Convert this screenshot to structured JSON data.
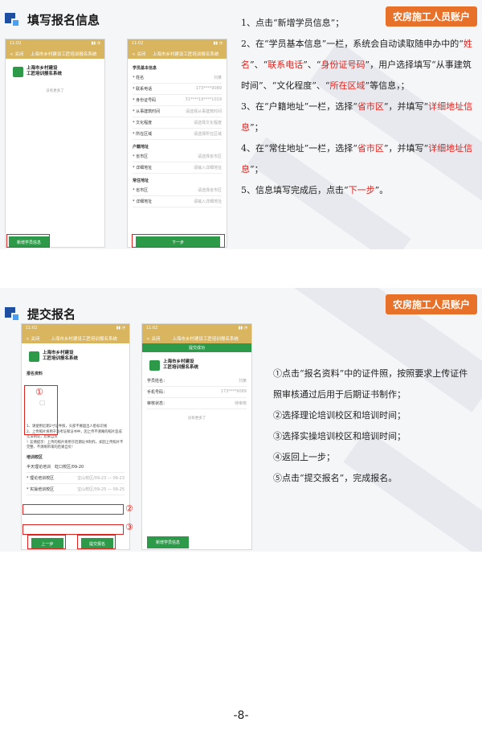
{
  "slide1": {
    "title": "填写报名信息",
    "badge": "农房施工人员账户",
    "phone_left": {
      "time": "11:02",
      "nav_back": "< 关闭",
      "nav_title": "上海市乡村建设工匠培训报名系统",
      "app_name_line1": "上海市乡村建设",
      "app_name_line2": "工匠培训报名系统",
      "empty": "没有更多了",
      "button": "新增学员信息"
    },
    "phone_right": {
      "time": "11:02",
      "nav_back": "< 关闭",
      "nav_title": "上海市乡村建设工匠培训报名系统",
      "group1": "学员基本信息",
      "rows1": [
        {
          "k": "* 姓名",
          "v": "刘某"
        },
        {
          "k": "* 联系电话",
          "v": "173****9089"
        },
        {
          "k": "* 身份证号码",
          "v": "31****19****1019"
        },
        {
          "k": "* 从事建筑时间",
          "v": "请选择从事建筑时间"
        },
        {
          "k": "* 文化程度",
          "v": "请选择文化程度"
        },
        {
          "k": "* 所在区域",
          "v": "请选择所在区域"
        }
      ],
      "group2": "户籍地址",
      "rows2": [
        {
          "k": "* 省市区",
          "v": "请选择省市区"
        },
        {
          "k": "* 详细地址",
          "v": "请输入详细地址"
        }
      ],
      "group3": "常住地址",
      "rows3": [
        {
          "k": "* 省市区",
          "v": "请选择省市区"
        },
        {
          "k": "* 详细地址",
          "v": "请输入详细地址"
        }
      ],
      "button": "下一步"
    },
    "steps": [
      {
        "parts": [
          {
            "t": "1、点击“新增学员信息”；",
            "r": false
          }
        ]
      },
      {
        "parts": [
          {
            "t": "2、在“学员基本信息”一栏，系统会自动读取随申办中的“",
            "r": false
          },
          {
            "t": "姓名",
            "r": true
          },
          {
            "t": "”、“",
            "r": false
          },
          {
            "t": "联系电话",
            "r": true
          },
          {
            "t": "”、“",
            "r": false
          },
          {
            "t": "身份证号码",
            "r": true
          },
          {
            "t": "”，用户选择填写“从事建筑时间”、“文化程度”、“",
            "r": false
          },
          {
            "t": "所在区域",
            "r": true
          },
          {
            "t": "”等信息，；",
            "r": false
          }
        ]
      },
      {
        "parts": [
          {
            "t": "3、在“户籍地址”一栏，选择“",
            "r": false
          },
          {
            "t": "省市区",
            "r": true
          },
          {
            "t": "”，并填写“",
            "r": false
          },
          {
            "t": "详细地址信息",
            "r": true
          },
          {
            "t": "”；",
            "r": false
          }
        ]
      },
      {
        "parts": [
          {
            "t": "4、在“常住地址”一栏，选择“",
            "r": false
          },
          {
            "t": "省市区",
            "r": true
          },
          {
            "t": "”，并填写“",
            "r": false
          },
          {
            "t": "详细地址信息",
            "r": true
          },
          {
            "t": "”；",
            "r": false
          }
        ]
      },
      {
        "parts": [
          {
            "t": "5、信息填写完成后，点击“",
            "r": false
          },
          {
            "t": "下一步",
            "r": true
          },
          {
            "t": "”。",
            "r": false
          }
        ]
      }
    ]
  },
  "slide2": {
    "title": "提交报名",
    "badge": "农房施工人员账户",
    "phone_left": {
      "time": "11:02",
      "nav_back": "< 关闭",
      "nav_title": "上海市乡村建设工匠培训报名系统",
      "app_name_line1": "上海市乡村建设",
      "app_name_line2": "工匠培训报名系统",
      "group1": "报名资料",
      "mark1": "①",
      "notes": [
        "1、请使用近期2寸证件照，头部不要超出人脸标识线",
        "2、上传照片将用于准考证和证书中，因上传不清晰的照片造成无法制证，后果自负",
        "！友情提示：上传的照片将用于后期证书制作，如因上传照片不完整、不清晰带来的后果自负！"
      ],
      "group2": "培训校区",
      "campus": "半天理论培训　虹口校区/09-20",
      "row_theory_k": "* 理论培训校区",
      "row_theory_v": "宝山校区/09-23 — 09-23",
      "mark2": "②",
      "row_prac_k": "* 实操培训校区",
      "row_prac_v": "宝山校区/09-25 — 09-25",
      "mark3": "③",
      "btn_prev": "上一步",
      "btn_submit": "提交报名"
    },
    "phone_right": {
      "time": "11:02",
      "nav_back": "< 关闭",
      "nav_title": "上海市乡村建设工匠培训报名系统",
      "tag": "提交成功",
      "app_name_line1": "上海市乡村建设",
      "app_name_line2": "工匠培训报名系统",
      "rows": [
        {
          "k": "学员姓名：",
          "v": "刘某"
        },
        {
          "k": "手机号码：",
          "v": "173****9089"
        },
        {
          "k": "审核状态：",
          "v": "待审核"
        }
      ],
      "empty": "没有更多了",
      "button": "新增学员信息"
    },
    "steps": [
      "①点击“报名资料”中的证件照，按照要求上传证件照审核通过后用于后期证书制作；",
      "②选择理论培训校区和培训时间；",
      "③选择实操培训校区和培训时间；",
      "④返回上一步；",
      "⑤点击“提交报名”，完成报名。"
    ]
  },
  "page_number": "-8-"
}
